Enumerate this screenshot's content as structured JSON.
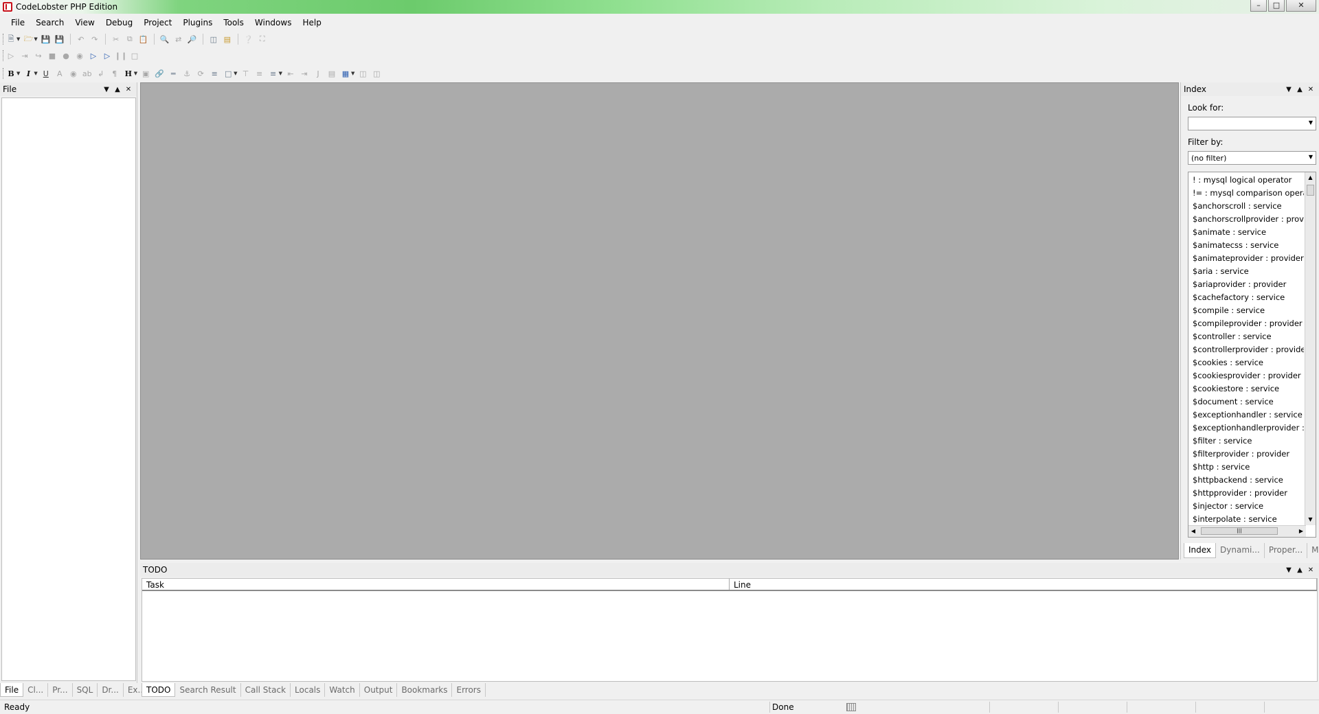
{
  "window": {
    "title": "CodeLobster PHP Edition"
  },
  "menu": [
    "File",
    "Search",
    "View",
    "Debug",
    "Project",
    "Plugins",
    "Tools",
    "Windows",
    "Help"
  ],
  "left_panel": {
    "title": "File"
  },
  "left_tabs": [
    "File",
    "Cl...",
    "Pr...",
    "SQL",
    "Dr...",
    "Ex..."
  ],
  "index_panel": {
    "title": "Index",
    "look_for_label": "Look for:",
    "look_for_value": "",
    "filter_by_label": "Filter by:",
    "filter_value": "(no filter)",
    "items": [
      "! : mysql logical operator",
      "!= : mysql comparison operator",
      "$anchorscroll : service",
      "$anchorscrollprovider : provider",
      "$animate : service",
      "$animatecss : service",
      "$animateprovider : provider",
      "$aria : service",
      "$ariaprovider : provider",
      "$cachefactory : service",
      "$compile : service",
      "$compileprovider : provider",
      "$controller : service",
      "$controllerprovider : provider",
      "$cookies : service",
      "$cookiesprovider : provider",
      "$cookiestore : service",
      "$document : service",
      "$exceptionhandler : service",
      "$exceptionhandlerprovider : provider",
      "$filter : service",
      "$filterprovider : provider",
      "$http : service",
      "$httpbackend : service",
      "$httpprovider : provider",
      "$injector : service",
      "$interpolate : service"
    ],
    "tabs": [
      "Index",
      "Dynami...",
      "Proper...",
      "Map"
    ]
  },
  "todo_panel": {
    "title": "TODO",
    "columns": [
      "Task",
      "Line"
    ]
  },
  "bottom_tabs": [
    "TODO",
    "Search Result",
    "Call Stack",
    "Locals",
    "Watch",
    "Output",
    "Bookmarks",
    "Errors"
  ],
  "status": {
    "left": "Ready",
    "middle": "Done"
  }
}
